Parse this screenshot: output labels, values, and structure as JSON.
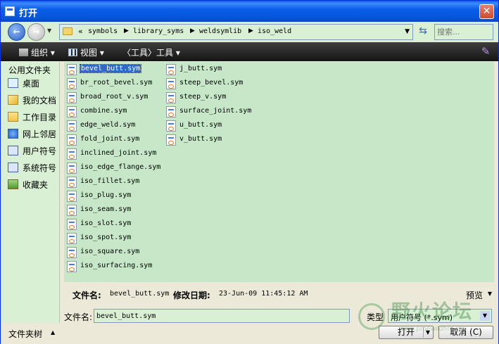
{
  "window": {
    "title": "打开",
    "close_label": "✕"
  },
  "address": {
    "prefix": "«",
    "crumbs": [
      "symbols",
      "library_syms",
      "weldsymlib",
      "iso_weld"
    ],
    "search_placeholder": "搜索..."
  },
  "toolbar": {
    "organize": "组织",
    "views": "视图",
    "tools": "〈工具〉工具"
  },
  "sidebar": {
    "header": "公用文件夹",
    "items": [
      {
        "label": "桌面",
        "icon": "desktop-icon"
      },
      {
        "label": "我的文档",
        "icon": "documents-icon"
      },
      {
        "label": "工作目录",
        "icon": "working-directory-icon"
      },
      {
        "label": "网上邻居",
        "icon": "network-icon"
      },
      {
        "label": "用户符号",
        "icon": "user-symbols-icon"
      },
      {
        "label": "系统符号",
        "icon": "system-symbols-icon"
      },
      {
        "label": "收藏夹",
        "icon": "favorites-icon"
      }
    ]
  },
  "files": {
    "column1": [
      "bevel_butt.sym",
      "br_root_bevel.sym",
      "broad_root_v.sym",
      "combine.sym",
      "edge_weld.sym",
      "fold_joint.sym",
      "inclined_joint.sym",
      "iso_edge_flange.sym",
      "iso_fillet.sym",
      "iso_plug.sym",
      "iso_seam.sym",
      "iso_slot.sym",
      "iso_spot.sym",
      "iso_square.sym",
      "iso_surfacing.sym"
    ],
    "column2": [
      "j_butt.sym",
      "steep_bevel.sym",
      "steep_v.sym",
      "surface_joint.sym",
      "u_butt.sym",
      "v_butt.sym"
    ],
    "selected": "bevel_butt.sym"
  },
  "details": {
    "filename_label": "文件名:",
    "filename_value": "bevel_butt.sym",
    "modified_label": "修改日期:",
    "modified_value": "23-Jun-09 11:45:12 AM",
    "preview_label": "预览"
  },
  "filename_row": {
    "label": "文件名:",
    "value": "bevel_butt.sym",
    "type_label": "类型",
    "type_value": "用户符号 (*.sym)"
  },
  "bottom": {
    "folders_label": "文件夹树",
    "open_label": "打开",
    "cancel_label": "取消 (C)"
  },
  "watermark": {
    "text": "野火论坛",
    "url": "www.proewildfire.cn"
  }
}
